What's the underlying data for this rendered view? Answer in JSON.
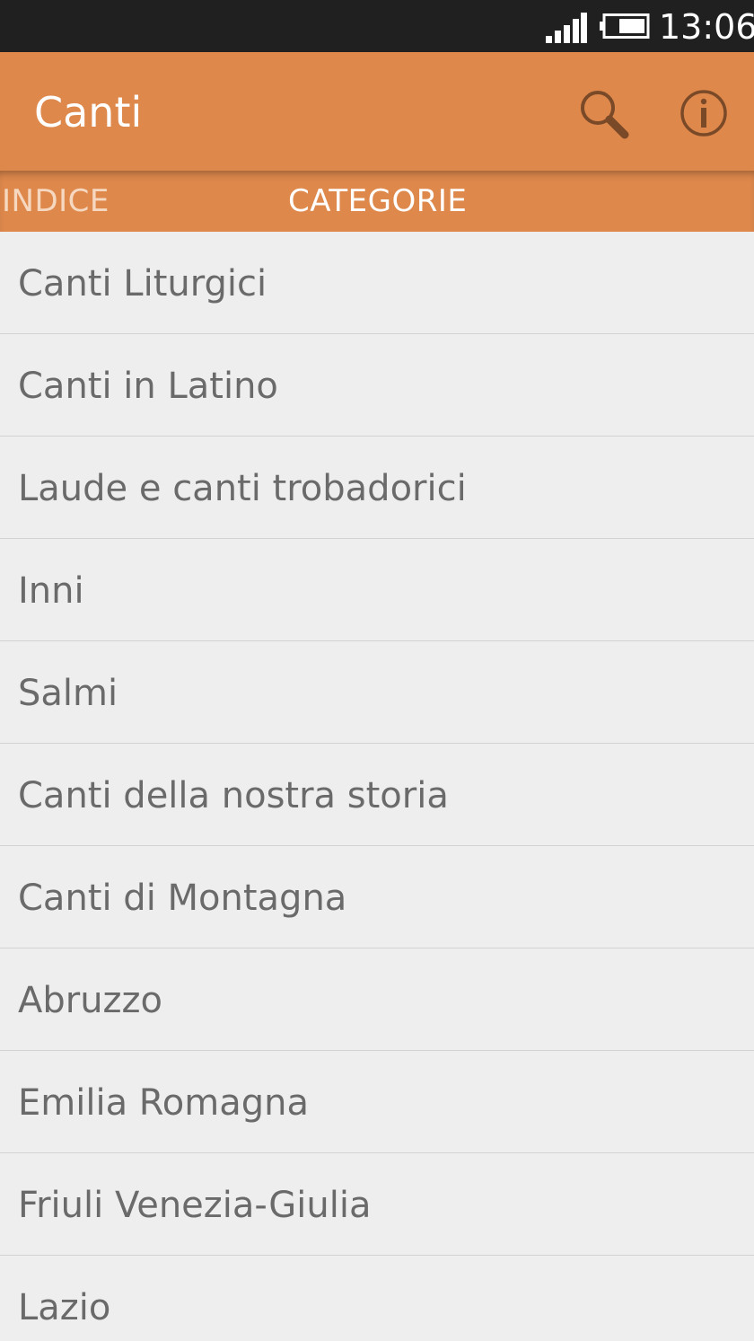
{
  "status_bar": {
    "time": "13:06",
    "signal_icon": "signal-icon",
    "battery_icon": "battery-icon"
  },
  "action_bar": {
    "title": "Canti",
    "search_icon": "search-icon",
    "info_icon": "info-icon",
    "background_color": "#de884c"
  },
  "tabs": [
    {
      "label": "INDICE",
      "selected": false
    },
    {
      "label": "CATEGORIE",
      "selected": true
    }
  ],
  "categories": [
    {
      "label": "Canti Liturgici"
    },
    {
      "label": "Canti in Latino"
    },
    {
      "label": "Laude e canti trobadorici"
    },
    {
      "label": "Inni"
    },
    {
      "label": "Salmi"
    },
    {
      "label": "Canti della nostra storia"
    },
    {
      "label": "Canti di Montagna"
    },
    {
      "label": "Abruzzo"
    },
    {
      "label": "Emilia Romagna"
    },
    {
      "label": "Friuli Venezia-Giulia"
    },
    {
      "label": "Lazio"
    }
  ]
}
